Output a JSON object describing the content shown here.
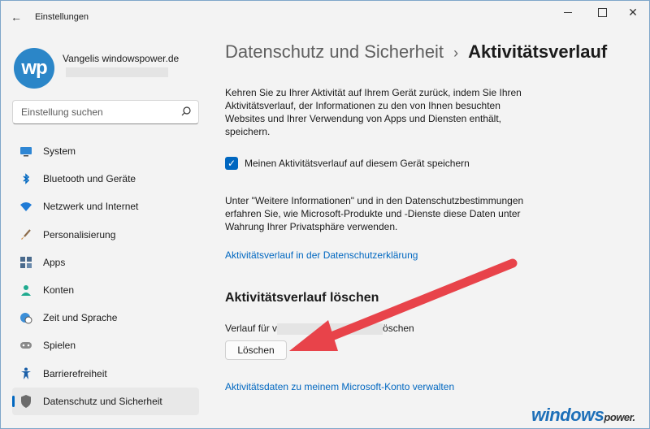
{
  "window": {
    "title": "Einstellungen",
    "back_glyph": "←",
    "close_glyph": "✕"
  },
  "user": {
    "avatar_text": "wp",
    "name": "Vangelis windowspower.de"
  },
  "search": {
    "placeholder": "Einstellung suchen"
  },
  "sidebar": {
    "items": [
      {
        "label": "System",
        "icon": "monitor-icon"
      },
      {
        "label": "Bluetooth und Geräte",
        "icon": "bluetooth-icon"
      },
      {
        "label": "Netzwerk und Internet",
        "icon": "wifi-icon"
      },
      {
        "label": "Personalisierung",
        "icon": "brush-icon"
      },
      {
        "label": "Apps",
        "icon": "apps-icon"
      },
      {
        "label": "Konten",
        "icon": "person-icon"
      },
      {
        "label": "Zeit und Sprache",
        "icon": "globe-clock-icon"
      },
      {
        "label": "Spielen",
        "icon": "gamepad-icon"
      },
      {
        "label": "Barrierefreiheit",
        "icon": "accessibility-icon"
      },
      {
        "label": "Datenschutz und Sicherheit",
        "icon": "shield-icon",
        "active": true
      }
    ]
  },
  "main": {
    "breadcrumb_parent": "Datenschutz und Sicherheit",
    "breadcrumb_sep": "›",
    "breadcrumb_current": "Aktivitätsverlauf",
    "intro": "Kehren Sie zu Ihrer Aktivität auf Ihrem Gerät zurück, indem Sie Ihren Aktivitätsverlauf, der Informationen zu den von Ihnen besuchten Websites und Ihrer Verwendung von Apps und Diensten enthält, speichern.",
    "checkbox_label": "Meinen Aktivitätsverlauf auf diesem Gerät speichern",
    "checkbox_checked": true,
    "checkbox_glyph": "✓",
    "info": "Unter \"Weitere Informationen\" und in den Datenschutzbestimmungen erfahren Sie, wie Microsoft-Produkte und -Dienste diese Daten unter Wahrung Ihrer Privatsphäre verwenden.",
    "privacy_link": "Aktivitätsverlauf in der Datenschutzerklärung",
    "section_title": "Aktivitätsverlauf löschen",
    "history_prefix": "Verlauf für v",
    "history_suffix": "öschen",
    "delete_button": "Löschen",
    "account_link": "Aktivitätsdaten zu meinem Microsoft-Konto verwalten"
  },
  "watermark": {
    "text": "windows",
    "suffix": "power."
  },
  "colors": {
    "accent": "#0067c0",
    "annotation_arrow": "#e8434a"
  }
}
